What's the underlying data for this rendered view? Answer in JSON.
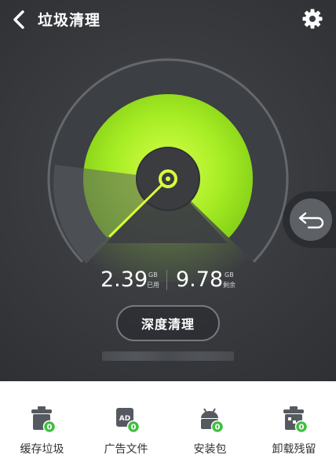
{
  "header": {
    "title": "垃圾清理"
  },
  "storage": {
    "used_value": "2.39",
    "used_unit": "GB",
    "used_label": "已用",
    "free_value": "9.78",
    "free_unit": "GB",
    "free_label": "剩余"
  },
  "actions": {
    "deep_clean_label": "深度清理"
  },
  "tools": [
    {
      "label": "缓存垃圾",
      "count": "0",
      "icon": "trash-bin-icon"
    },
    {
      "label": "广告文件",
      "count": "0",
      "icon": "ad-file-icon"
    },
    {
      "label": "安装包",
      "count": "0",
      "icon": "android-package-icon"
    },
    {
      "label": "卸载残留",
      "count": "0",
      "icon": "residual-trash-icon"
    }
  ],
  "colors": {
    "accent": "#9ee52a",
    "dark_bg": "#35373b",
    "badge": "#3fbf3f"
  }
}
